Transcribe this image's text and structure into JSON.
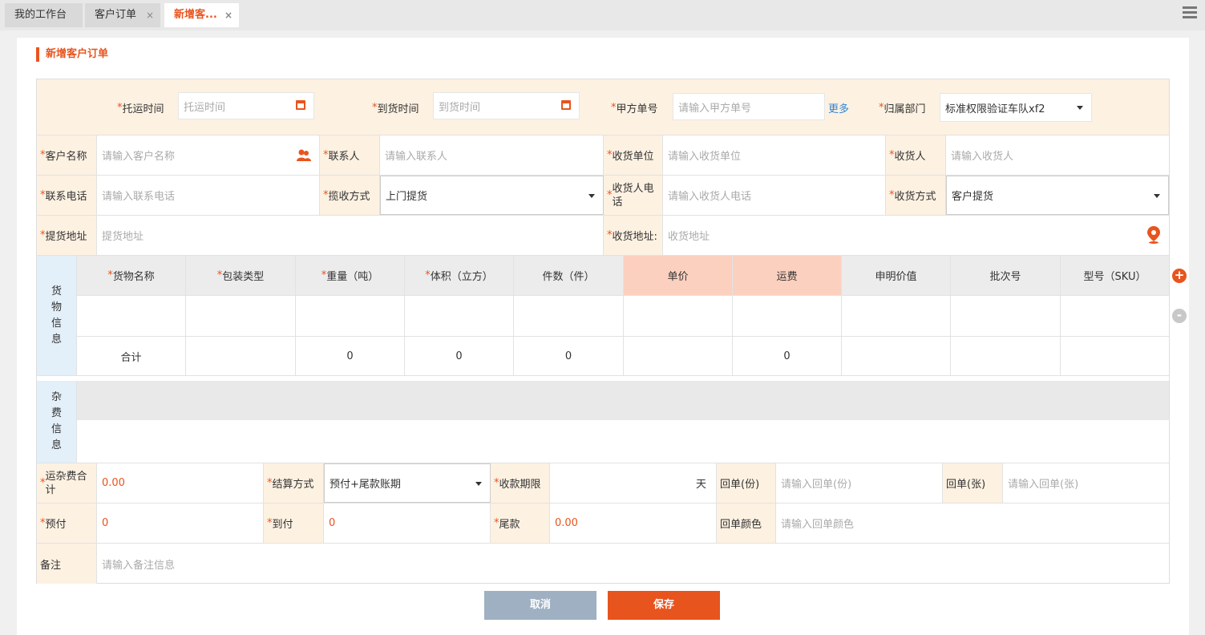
{
  "tabs": [
    {
      "label": "我的工作台"
    },
    {
      "label": "客户订单",
      "close": "×"
    },
    {
      "label": "新增客...",
      "close": "×"
    }
  ],
  "page_title": "新增客户订单",
  "top": {
    "ship_time": {
      "label": "托运时间",
      "placeholder": "托运时间"
    },
    "arrive_time": {
      "label": "到货时间",
      "placeholder": "到货时间"
    },
    "party_no": {
      "label": "甲方单号",
      "placeholder": "请输入甲方单号"
    },
    "more": "更多",
    "dept": {
      "label": "归属部门",
      "value": "标准权限验证车队xf2"
    }
  },
  "row1": {
    "customer": {
      "label": "客户名称",
      "placeholder": "请输入客户名称"
    },
    "contact": {
      "label": "联系人",
      "placeholder": "请输入联系人"
    },
    "consignee_unit": {
      "label": "收货单位",
      "placeholder": "请输入收货单位"
    },
    "consignee": {
      "label": "收货人",
      "placeholder": "请输入收货人"
    }
  },
  "row2": {
    "phone": {
      "label": "联系电话",
      "placeholder": "请输入联系电话"
    },
    "pickup_mode": {
      "label": "揽收方式",
      "value": "上门提货"
    },
    "consignee_phone": {
      "label": "收货人电话",
      "placeholder": "请输入收货人电话"
    },
    "receive_mode": {
      "label": "收货方式",
      "value": "客户提货"
    }
  },
  "row3": {
    "pickup_addr": {
      "label": "提货地址",
      "placeholder": "提货地址"
    },
    "recv_addr": {
      "label": "收货地址:",
      "placeholder": "收货地址"
    }
  },
  "goods": {
    "section_label": "货物信息",
    "headers": [
      "货物名称",
      "包装类型",
      "重量（吨）",
      "体积（立方）",
      "件数（件）",
      "单价",
      "运费",
      "申明价值",
      "批次号",
      "型号（SKU）"
    ],
    "required": [
      true,
      true,
      true,
      true,
      false,
      false,
      false,
      false,
      false,
      false
    ],
    "total_label": "合计",
    "totals": [
      "",
      "",
      "0",
      "0",
      "0",
      "",
      "0",
      "",
      "",
      ""
    ]
  },
  "misc": {
    "section_label": "杂费信息"
  },
  "fee": {
    "total": {
      "label": "运杂费合计",
      "value": "0.00"
    },
    "settle": {
      "label": "结算方式",
      "value": "预付+尾款账期"
    },
    "term": {
      "label": "收款期限",
      "unit": "天"
    },
    "receipt_copies": {
      "label": "回单(份)",
      "placeholder": "请输入回单(份)"
    },
    "receipt_sheets": {
      "label": "回单(张)",
      "placeholder": "请输入回单(张)"
    }
  },
  "pay": {
    "prepay": {
      "label": "预付",
      "value": "0"
    },
    "topay": {
      "label": "到付",
      "value": "0"
    },
    "balance": {
      "label": "尾款",
      "value": "0.00"
    },
    "receipt_color": {
      "label": "回单颜色",
      "placeholder": "请输入回单颜色"
    }
  },
  "remark": {
    "label": "备注",
    "placeholder": "请输入备注信息"
  },
  "buttons": {
    "cancel": "取消",
    "save": "保存"
  },
  "colors": {
    "accent": "#e8541e",
    "label_bg": "#fdf1e2",
    "cancel_bg": "#9eb0c2"
  }
}
